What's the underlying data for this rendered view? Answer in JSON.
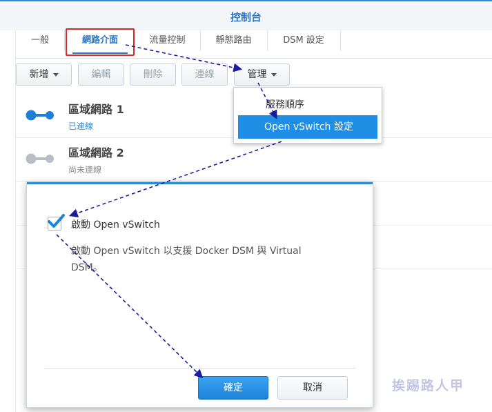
{
  "window": {
    "title": "控制台"
  },
  "tabs": [
    {
      "label": "一般",
      "active": false
    },
    {
      "label": "網路介面",
      "active": true
    },
    {
      "label": "流量控制",
      "active": false
    },
    {
      "label": "靜態路由",
      "active": false
    },
    {
      "label": "DSM 設定",
      "active": false
    }
  ],
  "toolbar": {
    "create": "新增",
    "edit": "編輯",
    "delete": "刪除",
    "connect": "連線",
    "manage": "管理"
  },
  "manage_menu": {
    "service_order": "服務順序",
    "open_vswitch": "Open vSwitch 設定"
  },
  "networks": [
    {
      "name": "區域網路 1",
      "status": "已連線",
      "status_color": "#2a8fd6",
      "icon_color": "#1f7fd6"
    },
    {
      "name": "區域網路 2",
      "status": "尚未連線",
      "status_color": "#888888",
      "icon_color": "#b9bec4"
    }
  ],
  "dialog": {
    "checkbox_label": "啟動 Open vSwitch",
    "checked": true,
    "description": "啟動 Open vSwitch 以支援 Docker DSM 與 Virtual DSM。",
    "ok": "確定",
    "cancel": "取消"
  },
  "watermark": "挨踢路人甲",
  "colors": {
    "accent": "#2a78c6",
    "primary_button": "#1f83d8",
    "highlight_box": "#d62b2b",
    "arrow": "#1a1aa0"
  }
}
